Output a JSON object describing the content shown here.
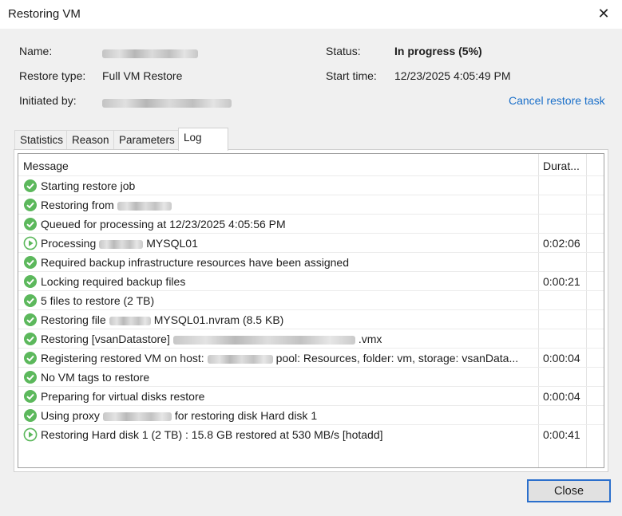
{
  "window": {
    "title": "Restoring VM",
    "close_icon": "close-icon"
  },
  "info": {
    "name_label": "Name:",
    "restore_type_label": "Restore type:",
    "restore_type_value": "Full VM Restore",
    "initiated_by_label": "Initiated by:",
    "status_label": "Status:",
    "status_value": "In progress (5%)",
    "start_time_label": "Start time:",
    "start_time_value": "12/23/2025 4:05:49 PM",
    "cancel_link": "Cancel restore task"
  },
  "tabs": [
    {
      "label": "Statistics",
      "active": false
    },
    {
      "label": "Reason",
      "active": false
    },
    {
      "label": "Parameters",
      "active": false
    },
    {
      "label": "Log",
      "active": true
    }
  ],
  "log": {
    "columns": {
      "message": "Message",
      "duration": "Durat..."
    },
    "rows": [
      {
        "icon": "success-icon",
        "message": "Starting restore job",
        "duration": ""
      },
      {
        "icon": "success-icon",
        "message": "Restoring from",
        "duration": ""
      },
      {
        "icon": "success-icon",
        "message": "Queued for processing at 12/23/2025 4:05:56 PM",
        "duration": ""
      },
      {
        "icon": "running-icon",
        "message": "Processing",
        "message_b": "MYSQL01",
        "duration": "0:02:06"
      },
      {
        "icon": "success-icon",
        "message": "Required backup infrastructure resources have been assigned",
        "duration": ""
      },
      {
        "icon": "success-icon",
        "message": "Locking required backup files",
        "duration": "0:00:21"
      },
      {
        "icon": "success-icon",
        "message": "5 files to restore (2 TB)",
        "duration": ""
      },
      {
        "icon": "success-icon",
        "message": "Restoring file",
        "message_b": "MYSQL01.nvram (8.5 KB)",
        "duration": ""
      },
      {
        "icon": "success-icon",
        "message": "Restoring [vsanDatastore]",
        "message_b": ".vmx",
        "duration": ""
      },
      {
        "icon": "success-icon",
        "message": "Registering restored VM on host:",
        "message_b": "pool: Resources, folder: vm, storage: vsanData...",
        "duration": "0:00:04"
      },
      {
        "icon": "success-icon",
        "message": "No VM tags to restore",
        "duration": ""
      },
      {
        "icon": "success-icon",
        "message": "Preparing for virtual disks restore",
        "duration": "0:00:04"
      },
      {
        "icon": "success-icon",
        "message": "Using proxy",
        "message_b": "for restoring disk Hard disk 1",
        "duration": ""
      },
      {
        "icon": "running-icon",
        "message": "Restoring Hard disk 1 (2 TB) : 15.8 GB restored at 530 MB/s  [hotadd]",
        "duration": "0:00:41"
      }
    ]
  },
  "footer": {
    "close_label": "Close"
  },
  "colors": {
    "success": "#5cb85c",
    "running": "#5cb85c",
    "link": "#1a6fc9",
    "focus_border": "#2b6fcc"
  }
}
